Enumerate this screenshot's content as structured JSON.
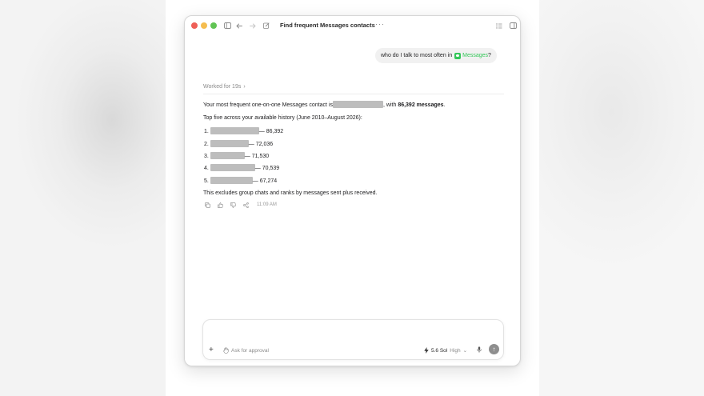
{
  "window": {
    "title": "Find frequent Messages contacts",
    "more": "···"
  },
  "user_message": {
    "text": "who do I talk to most often in",
    "app": "Messages",
    "suffix": "?"
  },
  "assistant": {
    "worked_label": "Worked for 19s",
    "worked_chevron": "›",
    "line1_prefix": "Your most frequent one-on-one Messages contact is",
    "line1_mid": ", with",
    "line1_bold": "86,392 messages",
    "line1_end": ".",
    "line2": "Top five across your available history (June 2010–August 2026):",
    "list": [
      {
        "num": "1.",
        "count": "— 86,392"
      },
      {
        "num": "2.",
        "count": "— 72,036"
      },
      {
        "num": "3.",
        "count": "— 71,530"
      },
      {
        "num": "4.",
        "count": "— 70,539"
      },
      {
        "num": "5.",
        "count": "— 67,274"
      }
    ],
    "footer": "This excludes group chats and ranks by messages sent plus received.",
    "time": "11:09 AM"
  },
  "composer": {
    "plus": "+",
    "approval_label": "Ask for approval",
    "model": "5.6 Sol",
    "effort": "High",
    "chevron": "⌄",
    "send": "↑"
  },
  "icons": {
    "sidebar": "sidebar-icon",
    "back": "arrow-left-icon",
    "forward": "arrow-right-icon",
    "compose": "compose-icon",
    "list": "list-icon",
    "panel": "panel-icon",
    "copy": "copy-icon",
    "thumbs_up": "thumbs-up-icon",
    "thumbs_down": "thumbs-down-icon",
    "share": "share-icon",
    "hand": "hand-icon",
    "bolt": "bolt-icon",
    "mic": "mic-icon"
  }
}
